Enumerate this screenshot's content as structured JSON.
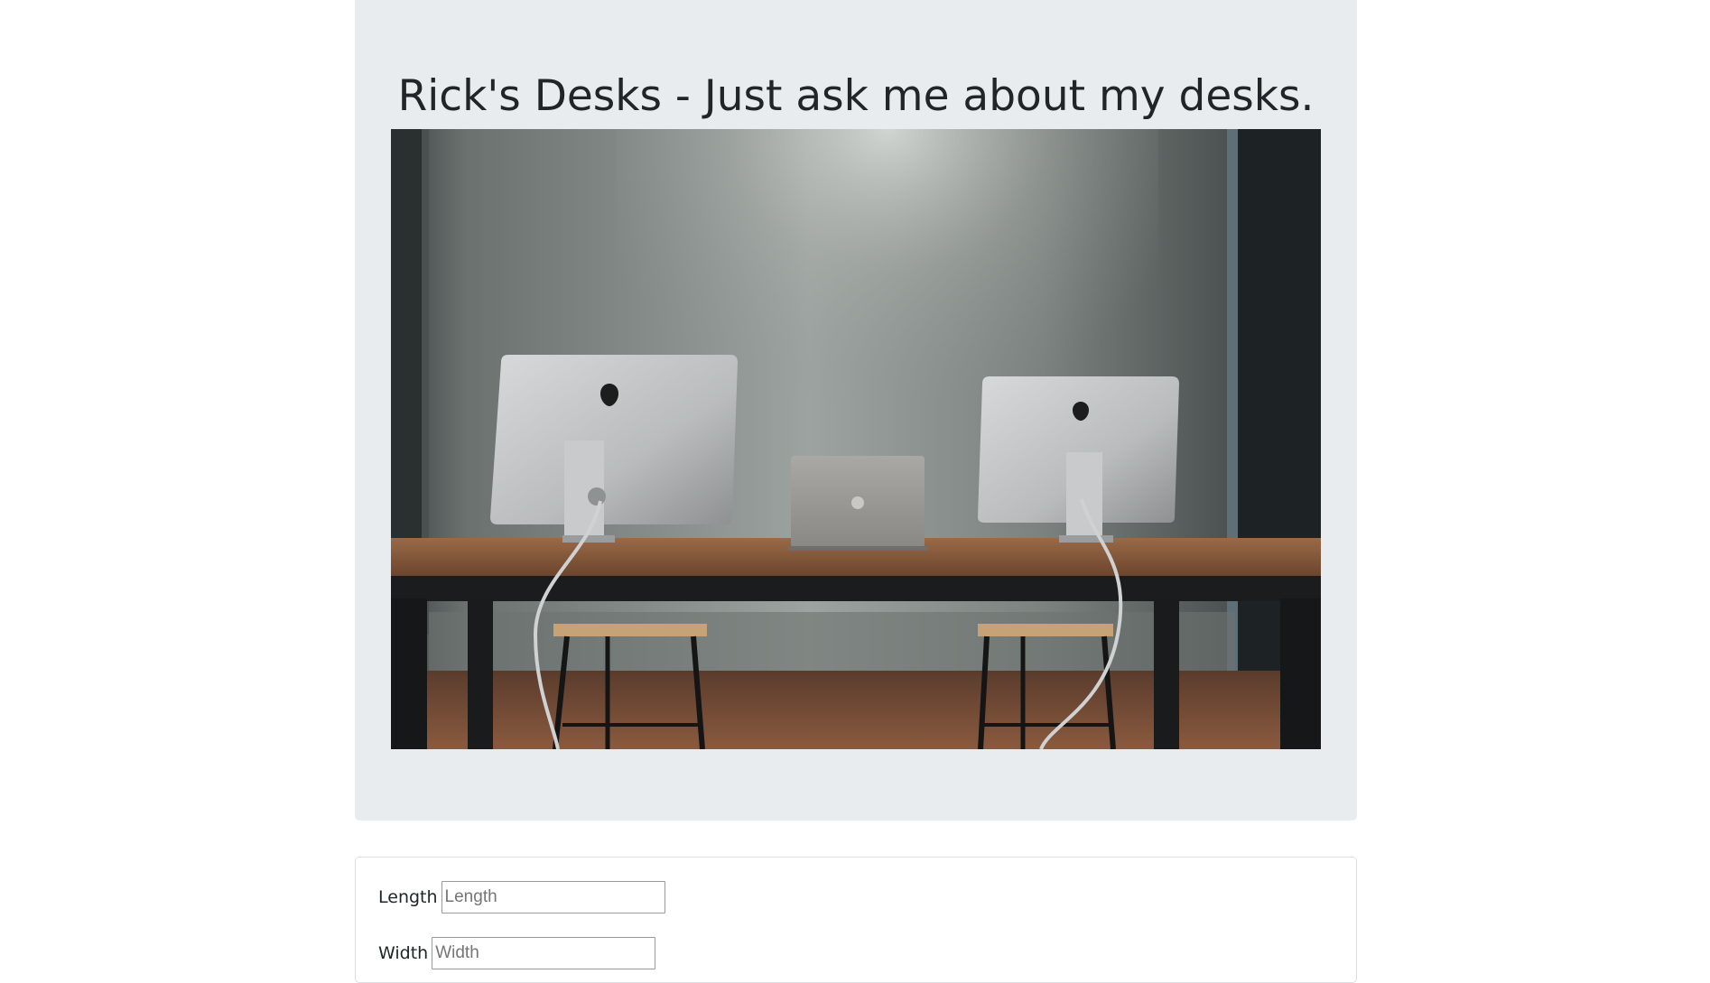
{
  "header": {
    "title": "Rick's Desks - Just ask me about my desks."
  },
  "hero_image": {
    "alt": "Two iMacs and a laptop on a wooden desk with stools against a concrete wall"
  },
  "form": {
    "length_label": "Length",
    "length_placeholder": "Length",
    "width_label": "Width",
    "width_placeholder": "Width"
  },
  "colors": {
    "jumbotron_bg": "#e9ecef",
    "text": "#212529"
  }
}
